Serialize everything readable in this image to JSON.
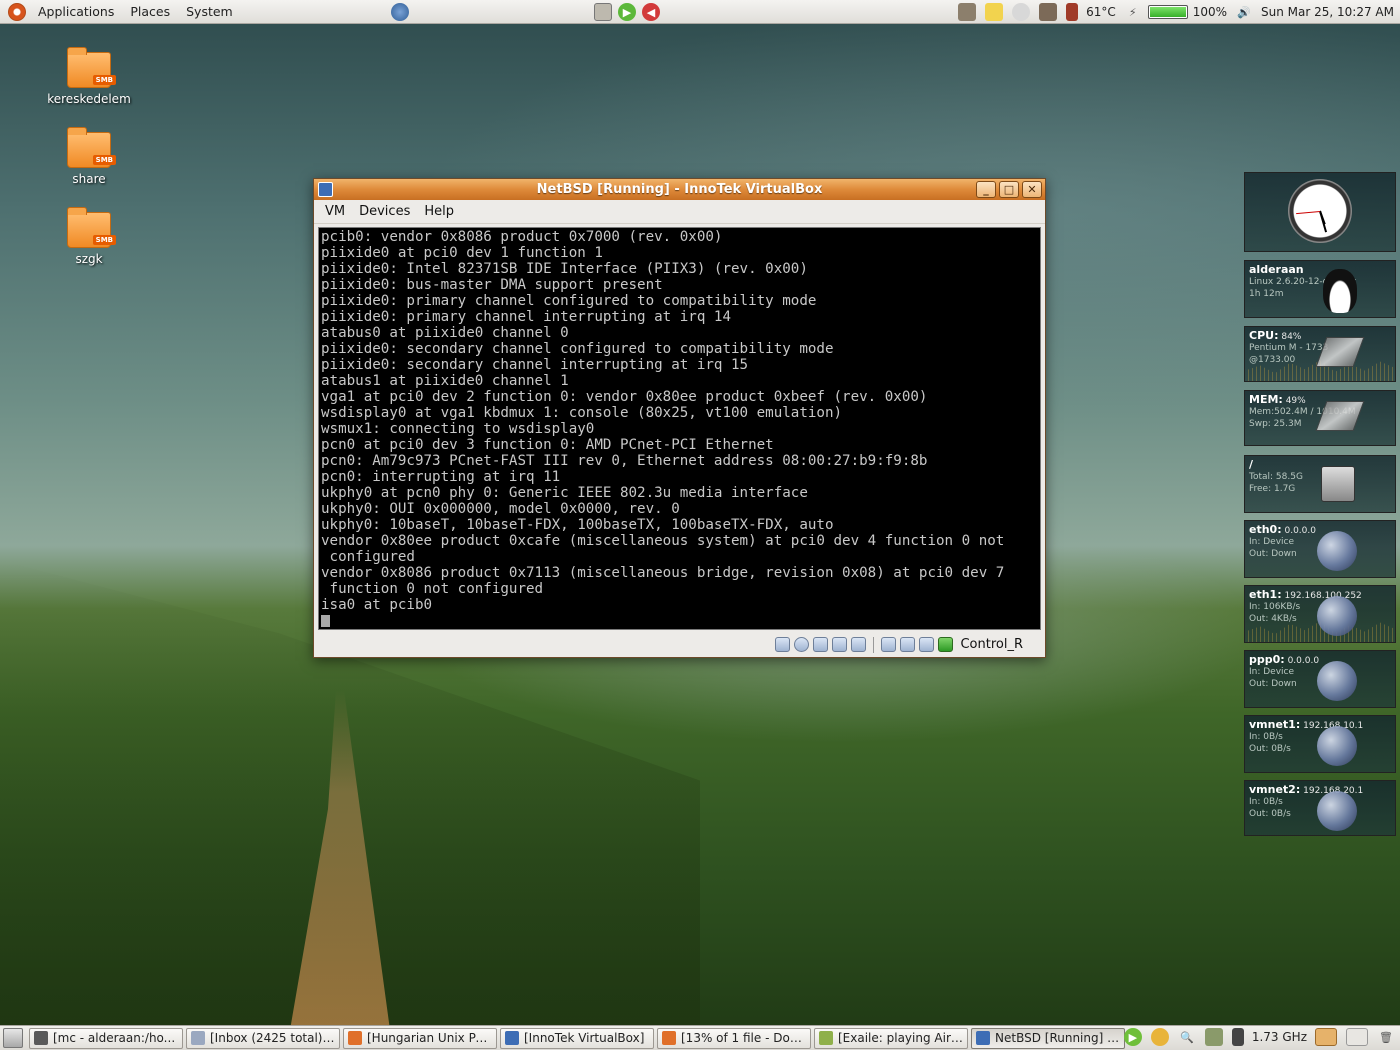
{
  "top_panel": {
    "menus": [
      "Applications",
      "Places",
      "System"
    ],
    "temperature": "61°C",
    "battery_percent": "100%",
    "battery_level": 1.0,
    "clock": "Sun Mar 25, 10:27 AM"
  },
  "desktop_icons": [
    {
      "label": "kereskedelem",
      "badge": "SMB"
    },
    {
      "label": "share",
      "badge": "SMB"
    },
    {
      "label": "szgk",
      "badge": "SMB"
    }
  ],
  "vbox_window": {
    "title": "NetBSD [Running] - InnoTek VirtualBox",
    "menus": [
      "VM",
      "Devices",
      "Help"
    ],
    "console_lines": [
      "pcib0: vendor 0x8086 product 0x7000 (rev. 0x00)",
      "piixide0 at pci0 dev 1 function 1",
      "piixide0: Intel 82371SB IDE Interface (PIIX3) (rev. 0x00)",
      "piixide0: bus-master DMA support present",
      "piixide0: primary channel configured to compatibility mode",
      "piixide0: primary channel interrupting at irq 14",
      "atabus0 at piixide0 channel 0",
      "piixide0: secondary channel configured to compatibility mode",
      "piixide0: secondary channel interrupting at irq 15",
      "atabus1 at piixide0 channel 1",
      "vga1 at pci0 dev 2 function 0: vendor 0x80ee product 0xbeef (rev. 0x00)",
      "wsdisplay0 at vga1 kbdmux 1: console (80x25, vt100 emulation)",
      "wsmux1: connecting to wsdisplay0",
      "pcn0 at pci0 dev 3 function 0: AMD PCnet-PCI Ethernet",
      "pcn0: Am79c973 PCnet-FAST III rev 0, Ethernet address 08:00:27:b9:f9:8b",
      "pcn0: interrupting at irq 11",
      "ukphy0 at pcn0 phy 0: Generic IEEE 802.3u media interface",
      "ukphy0: OUI 0x000000, model 0x0000, rev. 0",
      "ukphy0: 10baseT, 10baseT-FDX, 100baseTX, 100baseTX-FDX, auto",
      "vendor 0x80ee product 0xcafe (miscellaneous system) at pci0 dev 4 function 0 not",
      " configured",
      "vendor 0x8086 product 0x7113 (miscellaneous bridge, revision 0x08) at pci0 dev 7",
      " function 0 not configured",
      "isa0 at pcib0"
    ],
    "host_key": "Control_R"
  },
  "gkrellm": {
    "host": {
      "name": "alderaan",
      "line1": "Linux 2.6.20-12-generic",
      "line2": "1h 12m"
    },
    "cpu": {
      "label": "CPU:",
      "value": "84%",
      "line1": "Pentium M - 1733",
      "line2": "@1733.00"
    },
    "mem": {
      "label": "MEM:",
      "value": "49%",
      "line1": "Mem:502.4M / 1010.4M",
      "line2": "Swp: 25.3M"
    },
    "disk": {
      "label": "/",
      "line1": "Total: 58.5G",
      "line2": "Free: 1.7G"
    },
    "nets": [
      {
        "name": "eth0:",
        "ip": "0.0.0.0",
        "in": "In:   Device",
        "out": "Out: Down"
      },
      {
        "name": "eth1:",
        "ip": "192.168.100.252",
        "in": "In:   106KB/s",
        "out": "Out: 4KB/s"
      },
      {
        "name": "ppp0:",
        "ip": "0.0.0.0",
        "in": "In:   Device",
        "out": "Out: Down"
      },
      {
        "name": "vmnet1:",
        "ip": "192.168.10.1",
        "in": "In:    0B/s",
        "out": "Out:  0B/s"
      },
      {
        "name": "vmnet2:",
        "ip": "192.168.20.1",
        "in": "In:    0B/s",
        "out": "Out:  0B/s"
      }
    ]
  },
  "taskbar": {
    "tasks": [
      {
        "label": "[mc - alderaan:/ho...",
        "icon_color": "#5a5a5a"
      },
      {
        "label": "[Inbox (2425 total) -...",
        "icon_color": "#9aa8c0"
      },
      {
        "label": "[Hungarian Unix Po...",
        "icon_color": "#e0702a"
      },
      {
        "label": "[InnoTek VirtualBox]",
        "icon_color": "#3d6db5"
      },
      {
        "label": "[13% of 1 file - Dow...",
        "icon_color": "#e0702a"
      },
      {
        "label": "[Exaile: playing Air ...",
        "icon_color": "#8fb04a"
      },
      {
        "label": "NetBSD [Running] -...",
        "icon_color": "#3d6db5",
        "active": true
      }
    ],
    "cpu_freq": "1.73 GHz"
  }
}
